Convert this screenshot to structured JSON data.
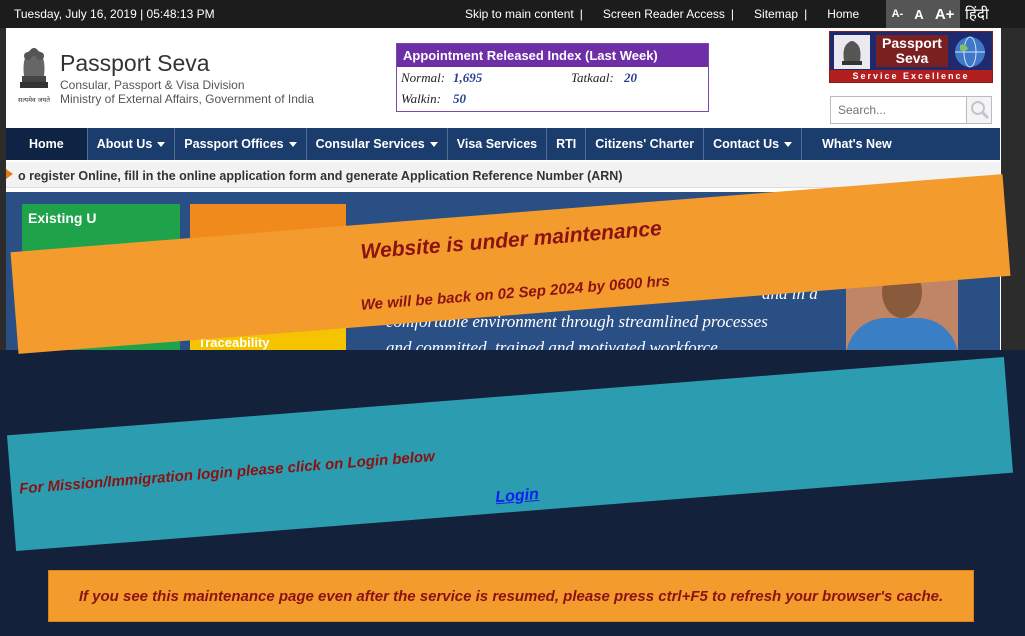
{
  "topbar": {
    "datetime": "Tuesday,  July  16, 2019 | 05:48:13 PM",
    "links": [
      "Skip to main content",
      "Screen Reader Access",
      "Sitemap",
      "Home"
    ],
    "separator": "|",
    "font_sizes": [
      "A-",
      "A",
      "A+"
    ],
    "language": "हिंदी"
  },
  "brand": {
    "emblem_caption": "सत्यमेव जयते",
    "title": "Passport Seva",
    "subtitle_line1": "Consular, Passport & Visa Division",
    "subtitle_line2": "Ministry of External Affairs, Government of India"
  },
  "appointment_index": {
    "heading": "Appointment Released Index (Last Week)",
    "normal_label": "Normal:",
    "normal_value": "1,695",
    "tatkaal_label": "Tatkaal:",
    "tatkaal_value": "20",
    "walkin_label": "Walkin:",
    "walkin_value": "50"
  },
  "logo_right": {
    "text_line1": "Passport",
    "text_line2": "Seva",
    "tagline": "Service Excellence"
  },
  "search": {
    "placeholder": "Search..."
  },
  "nav": {
    "items": [
      {
        "label": "Home",
        "dropdown": false
      },
      {
        "label": "About Us",
        "dropdown": true
      },
      {
        "label": "Passport Offices",
        "dropdown": true
      },
      {
        "label": "Consular Services",
        "dropdown": true
      },
      {
        "label": "Visa Services",
        "dropdown": false
      },
      {
        "label": "RTI",
        "dropdown": false
      },
      {
        "label": "Citizens' Charter",
        "dropdown": false
      },
      {
        "label": "Contact Us",
        "dropdown": true
      },
      {
        "label": "What's New",
        "dropdown": false
      }
    ]
  },
  "ticker": {
    "text": "o register Online, fill in the online application form and generate Application Reference Number (ARN)"
  },
  "hero": {
    "tile1_text": "Existing U",
    "tile3_text": "Traceability",
    "quote_line0": "and in a",
    "quote_line1": "comfortable environment through streamlined processes",
    "quote_line2": "and committed, trained and motivated workforce."
  },
  "maintenance": {
    "title": "Website is under maintenance",
    "subtitle": "We will be back on 02 Sep 2024 by 0600 hrs",
    "mission_text": "For Mission/Immigration login please click on Login below",
    "login_label": "Login",
    "cache_note": "If you see this maintenance page even after the service is resumed, please press ctrl+F5 to refresh your browser's cache."
  },
  "colors": {
    "nav_bg": "#1b3d6e",
    "orange_banner": "#f49b2e",
    "teal_banner": "#2c9db1",
    "dark_overlay": "#14213a",
    "alert_text": "#8a1212",
    "link": "#0b22ee",
    "appt_header": "#6e2ea6"
  }
}
